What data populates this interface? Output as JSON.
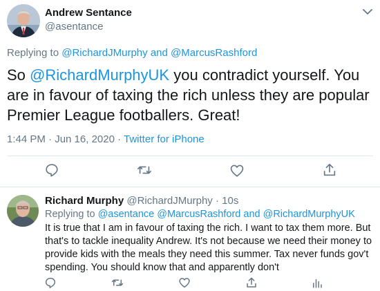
{
  "main_tweet": {
    "author_name": "Andrew Sentance",
    "author_handle": "@asentance",
    "replying_prefix": "Replying to",
    "replying_to_1": "@RichardJMurphy",
    "replying_and": "and",
    "replying_to_2": "@MarcusRashford",
    "text_prefix": "So",
    "text_mention": "@RichardMurphyUK",
    "text_body": "you contradict yourself. You are in favour of taxing the rich unless they are popular Premier League footballers. Great!",
    "time": "1:44 PM · Jun 16, 2020 ·",
    "source": "Twitter for iPhone",
    "actions": [
      "reply-icon",
      "retweet-icon",
      "like-icon",
      "share-icon"
    ]
  },
  "reply_tweet": {
    "author_name": "Richard Murphy",
    "author_handle": "@RichardJMurphy",
    "time": "· 10s",
    "replying_prefix": "Replying to",
    "replying_to_1": "@asentance",
    "replying_to_2": "@MarcusRashford",
    "replying_and": "and",
    "replying_to_3": "@RichardMurphyUK",
    "text": "It is true that I am in favour of taxing the rich. I want to tax them more. But that's to tackle inequality Andrew. It's not because we need their money to provide kids with the meals they need this summer. Tax never funds gov't spending. You should know that and apparently don't",
    "actions": [
      "reply-icon",
      "retweet-icon",
      "like-icon",
      "share-icon",
      "analytics-icon"
    ]
  },
  "colors": {
    "link": "#1b95e0",
    "muted": "#657786",
    "text": "#14171a",
    "divider": "#e1e8ed"
  }
}
